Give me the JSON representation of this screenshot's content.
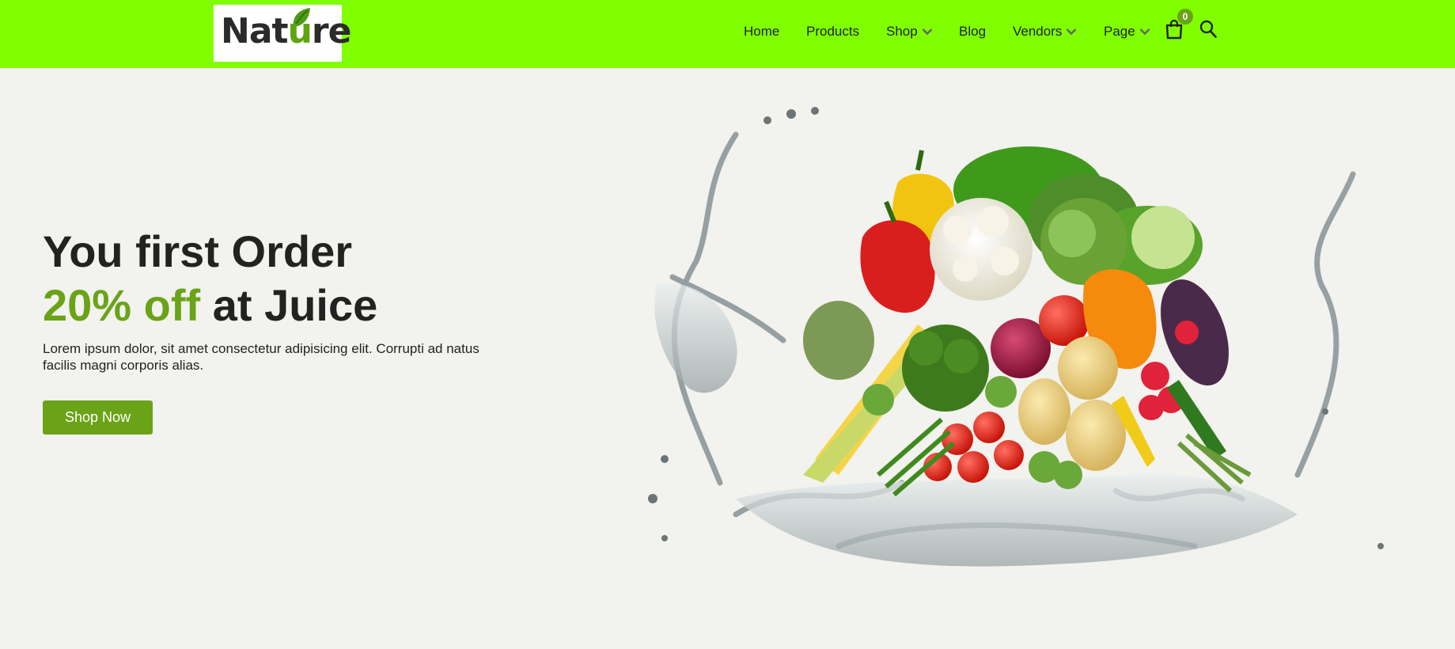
{
  "brand": {
    "logo_text_start": "Nat",
    "logo_text_u": "u",
    "logo_text_end": "re"
  },
  "nav": {
    "home": "Home",
    "products": "Products",
    "shop": "Shop",
    "blog": "Blog",
    "vendors": "Vendors",
    "page": "Page"
  },
  "cart": {
    "count": "0"
  },
  "hero": {
    "line1": "You first Order",
    "highlight": "20% off",
    "line2_rest": " at Juice",
    "description": "Lorem ipsum dolor, sit amet consectetur adipisicing elit. Corrupti ad natus facilis magni corporis alias.",
    "cta": "Shop Now"
  },
  "colors": {
    "header_bg": "#7fff00",
    "accent": "#6aa318",
    "page_bg": "#f2f2ee"
  },
  "icons": {
    "logo": "leaf-icon",
    "dropdown": "chevron-down-icon",
    "cart": "shopping-bag-icon",
    "search": "search-icon"
  }
}
